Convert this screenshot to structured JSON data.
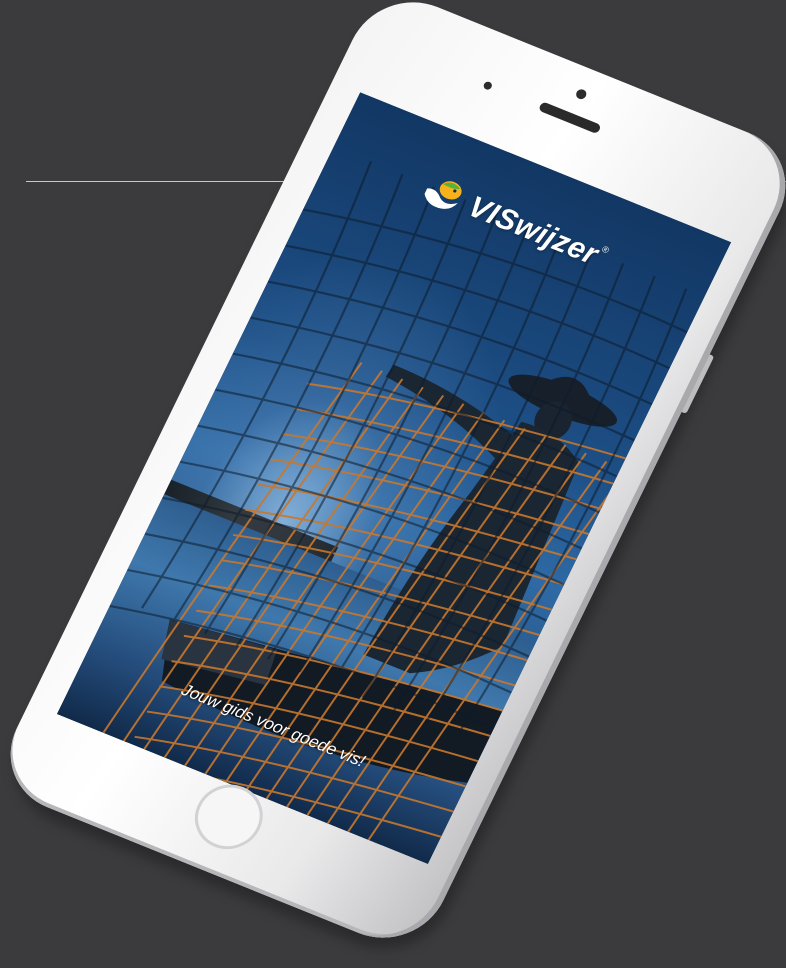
{
  "app": {
    "logo_text": "VISwijzer",
    "registered_mark": "®",
    "tagline": "Jouw gids voor goede vis!"
  },
  "icons": {
    "logo_mark": "fish-hand-logo-icon",
    "home_button": "home-button-icon"
  },
  "colors": {
    "background": "#3b3b3d",
    "sky_top": "#123764",
    "sky_mid": "#2f6aa5",
    "net": "#c8782e",
    "logo_text": "#ffffff"
  }
}
